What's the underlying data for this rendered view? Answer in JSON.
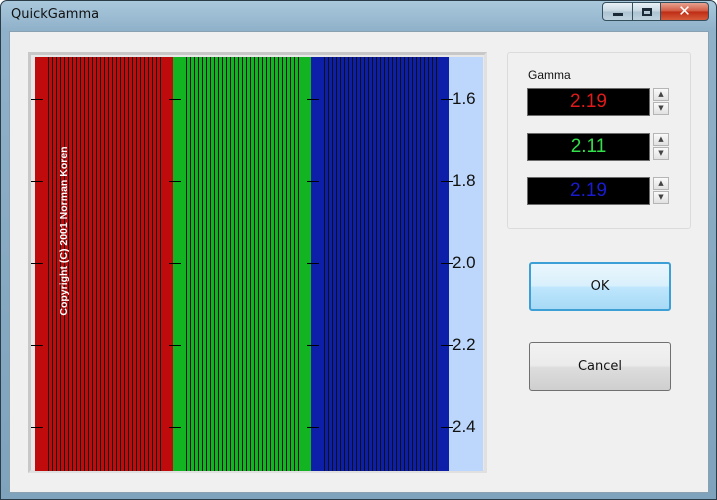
{
  "window": {
    "title": "QuickGamma"
  },
  "caption_buttons": {
    "minimize": "minimize-icon",
    "maximize": "maximize-icon",
    "close": "close-icon"
  },
  "chart": {
    "bands": [
      "red",
      "green",
      "blue"
    ],
    "band_colors": {
      "red": "#bf0b0b",
      "green": "#12b521",
      "blue": "#0d1ea8",
      "scale_bg": "#bcd7fb"
    },
    "scale_labels": [
      "1.6",
      "1.8",
      "2.0",
      "2.2",
      "2.4"
    ],
    "copyright": "Copyright (C) 2001  Norman Koren"
  },
  "gamma": {
    "label": "Gamma",
    "fields": [
      {
        "channel": "red",
        "value": "2.19",
        "color": "#e01a1a"
      },
      {
        "channel": "green",
        "value": "2.11",
        "color": "#32e04a"
      },
      {
        "channel": "blue",
        "value": "2.19",
        "color": "#1a1ad0"
      }
    ]
  },
  "buttons": {
    "ok": "OK",
    "cancel": "Cancel"
  }
}
